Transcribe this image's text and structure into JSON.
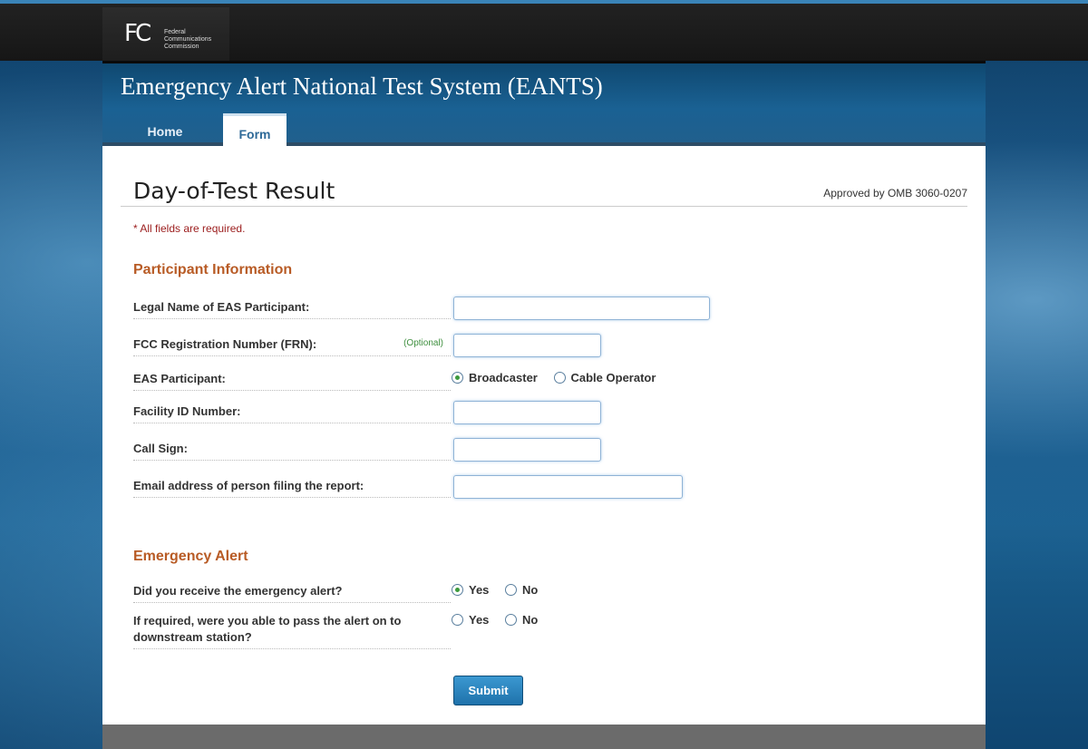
{
  "header": {
    "logo_mark": "FC",
    "logo_agency": [
      "Federal",
      "Communications",
      "Commission"
    ],
    "site_title": "Emergency Alert National Test System (EANTS)",
    "tabs": [
      {
        "label": "Home",
        "active": false
      },
      {
        "label": "Form",
        "active": true
      }
    ]
  },
  "page": {
    "title": "Day-of-Test Result",
    "omb": "Approved by OMB 3060-0207",
    "required_note": "* All fields are required."
  },
  "participant_section": {
    "heading": "Participant Information",
    "legal_name_label": "Legal Name of EAS Participant:",
    "legal_name_value": "",
    "frn_label": "FCC Registration Number (FRN):",
    "frn_optional": "(Optional)",
    "frn_value": "",
    "participant_label": "EAS Participant:",
    "participant_options": [
      {
        "label": "Broadcaster",
        "checked": true
      },
      {
        "label": "Cable Operator",
        "checked": false
      }
    ],
    "facility_label": "Facility ID Number:",
    "facility_value": "",
    "callsign_label": "Call Sign:",
    "callsign_value": "",
    "email_label": "Email address of person filing the report:",
    "email_value": ""
  },
  "alert_section": {
    "heading": "Emergency Alert",
    "received_label": "Did you receive the emergency alert?",
    "received_options": [
      {
        "label": "Yes",
        "checked": true
      },
      {
        "label": "No",
        "checked": false
      }
    ],
    "pass_label_line1": "If required, were you able to pass the alert on to",
    "pass_label_line2": "downstream station?",
    "pass_options": [
      {
        "label": "Yes",
        "checked": false
      },
      {
        "label": "No",
        "checked": false
      }
    ]
  },
  "submit_label": "Submit",
  "colors": {
    "section_heading": "#b85b25",
    "required": "#9b1c1c",
    "optional": "#3f8f3f",
    "button": "#1f72ab"
  }
}
